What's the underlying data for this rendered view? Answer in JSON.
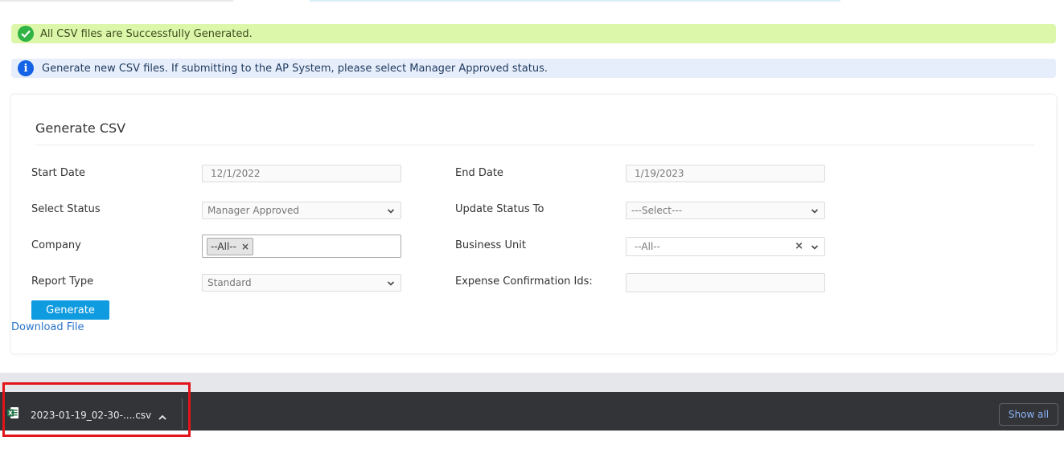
{
  "alerts": {
    "success": "All CSV files are Successfully Generated.",
    "info": "Generate new CSV files. If submitting to the AP System, please select Manager Approved status."
  },
  "form": {
    "title": "Generate CSV",
    "start_date": {
      "label": "Start Date",
      "value": "12/1/2022"
    },
    "end_date": {
      "label": "End Date",
      "value": "1/19/2023"
    },
    "select_status": {
      "label": "Select Status",
      "value": "Manager Approved"
    },
    "update_status": {
      "label": "Update Status To",
      "value": "---Select---"
    },
    "company": {
      "label": "Company",
      "tag": "--All--"
    },
    "business_unit": {
      "label": "Business Unit",
      "value": "--All--"
    },
    "report_type": {
      "label": "Report Type",
      "value": "Standard"
    },
    "expense_ids": {
      "label": "Expense Confirmation Ids:",
      "value": ""
    },
    "generate_label": "Generate",
    "download_label": "Download File"
  },
  "download_bar": {
    "filename": "2023-01-19_02-30-....csv",
    "show_all": "Show all"
  },
  "colors": {
    "success_bg": "#dcf7a9",
    "info_bg": "#e7eefb",
    "button": "#0f9be0",
    "download_bar": "#333437",
    "highlight": "#e3151b"
  }
}
